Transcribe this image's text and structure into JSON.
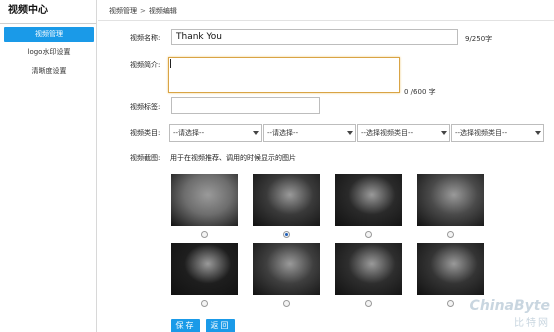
{
  "sidebar": {
    "title": "视频中心",
    "items": [
      {
        "label": "视频管理",
        "active": true
      },
      {
        "label": "logo水印设置",
        "active": false
      },
      {
        "label": "清晰度设置",
        "active": false
      }
    ]
  },
  "breadcrumb": {
    "parent": "视频管理",
    "current": "视频编辑"
  },
  "form": {
    "title_label": "视频名称:",
    "title_value": "Thank You",
    "title_counter": "9/250字",
    "intro_label": "视频简介:",
    "intro_counter": "0 /600 字",
    "tag_label": "视频标签:",
    "category_label": "视频类目:",
    "selects": [
      "--请选择--",
      "--请选择--",
      "--选择视频类目--",
      "--选择视频类目--"
    ],
    "cover_label": "视频截图:",
    "cover_hint": "用于在视频推荐、调用的时候显示的图片",
    "covers": [
      {
        "selected": false,
        "shade": "#6d6d6d"
      },
      {
        "selected": true,
        "shade": "#3a3a3a"
      },
      {
        "selected": false,
        "shade": "#2a2a2a"
      },
      {
        "selected": false,
        "shade": "#4a4a4a"
      },
      {
        "selected": false,
        "shade": "#1e1e1e"
      },
      {
        "selected": false,
        "shade": "#3f3f3f"
      },
      {
        "selected": false,
        "shade": "#2e2e2e"
      },
      {
        "selected": false,
        "shade": "#343434"
      }
    ],
    "save_label": "保存",
    "back_label": "返回"
  },
  "watermark": {
    "line1": "ChinaByte",
    "line2": "比特网"
  },
  "colors": {
    "accent": "#1a9ae8",
    "focus_border": "#d9a445"
  }
}
